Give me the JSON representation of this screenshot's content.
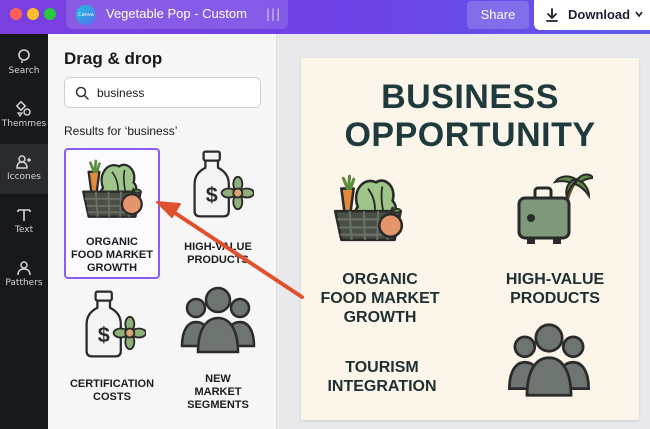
{
  "topbar": {
    "logo_text": "Canva",
    "doc_title": "Vegetable Pop - Custom",
    "share_label": "Share",
    "download_label": "Download"
  },
  "rail": {
    "items": [
      {
        "label": "Search",
        "icon": "search-icon"
      },
      {
        "label": "Themmes",
        "icon": "themes-icon"
      },
      {
        "label": "Iccones",
        "icon": "icons-icon"
      },
      {
        "label": "Text",
        "icon": "text-icon"
      },
      {
        "label": "Patthers",
        "icon": "patterns-icon"
      }
    ],
    "active_index": 2
  },
  "drawer": {
    "title": "Drag & drop",
    "search_value": "business",
    "results_label": "Results for ‘business’",
    "cards": [
      {
        "label_lines": [
          "ORGANIC",
          "FOOD MARKET",
          "GROWTH"
        ],
        "icon": "vegetable-basket-icon",
        "selected": true
      },
      {
        "label_lines": [
          "HIGH-VALUE",
          "PRODUCTS"
        ],
        "icon": "money-bottle-icon",
        "selected": false
      },
      {
        "label_lines": [
          "CERTIFICATION",
          "COSTS"
        ],
        "icon": "money-bottle-icon",
        "selected": false
      },
      {
        "label_lines": [
          "NEW",
          "MARKET",
          "SEGMENTS"
        ],
        "icon": "people-group-icon",
        "selected": false
      }
    ]
  },
  "slide": {
    "title_lines": [
      "BUSINESS",
      "OPPORTUNITY"
    ],
    "items": [
      {
        "label_lines": [
          "ORGANIC",
          "FOOD MARKET",
          "GROWTH"
        ],
        "icon": "vegetable-basket-icon"
      },
      {
        "label_lines": [
          "HIGH-VALUE",
          "PRODUCTS"
        ],
        "icon": "suitcase-palm-icon"
      },
      {
        "label_lines": [
          "TOURISM",
          "INTEGRATION"
        ],
        "icon": ""
      },
      {
        "label_lines": [],
        "icon": "people-group-icon"
      }
    ]
  },
  "colors": {
    "topbar_start": "#7b3fe0",
    "topbar_end": "#5f5be8",
    "rail_bg": "#18191b",
    "selection": "#8b5cf6",
    "arrow": "#e0502f",
    "slide_bg": "#fbf5ea",
    "title_color": "#1f3a3d"
  }
}
